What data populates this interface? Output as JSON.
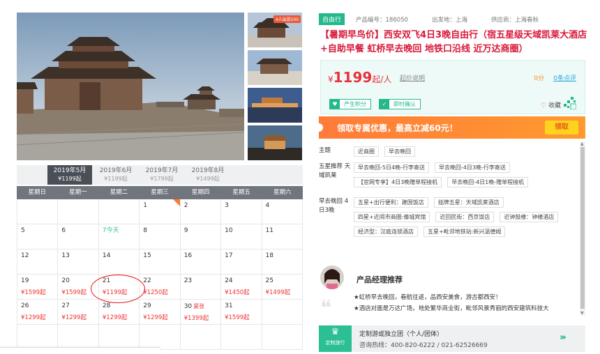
{
  "gallery": {
    "thumb_badge": "4人出游200"
  },
  "calendar": {
    "months": [
      {
        "label": "2019年5月",
        "price": "¥1199起",
        "active": true
      },
      {
        "label": "2019年6月",
        "price": "¥1199起"
      },
      {
        "label": "2019年7月",
        "price": "¥1799起"
      },
      {
        "label": "2019年8月",
        "price": "¥1499起"
      }
    ],
    "weekdays": [
      "星期日",
      "星期一",
      "星期二",
      "星期三",
      "星期四",
      "星期五",
      "星期六"
    ],
    "today_label": "今天",
    "rows": [
      [
        {
          "d": ""
        },
        {
          "d": ""
        },
        {
          "d": ""
        },
        {
          "d": "1",
          "flag": true
        },
        {
          "d": "2"
        },
        {
          "d": "3"
        },
        {
          "d": "4"
        }
      ],
      [
        {
          "d": "5"
        },
        {
          "d": "6"
        },
        {
          "d": "7",
          "today": true
        },
        {
          "d": "8"
        },
        {
          "d": "9"
        },
        {
          "d": "10"
        },
        {
          "d": "11"
        }
      ],
      [
        {
          "d": "12"
        },
        {
          "d": "13"
        },
        {
          "d": "14"
        },
        {
          "d": "15"
        },
        {
          "d": "16"
        },
        {
          "d": "17"
        },
        {
          "d": "18"
        }
      ],
      [
        {
          "d": "19",
          "p": "¥1599起"
        },
        {
          "d": "20",
          "p": "¥1599起"
        },
        {
          "d": "21",
          "p": "¥1199起"
        },
        {
          "d": "22",
          "p": "¥1250起"
        },
        {
          "d": "23"
        },
        {
          "d": "24",
          "p": "¥1450起"
        },
        {
          "d": "25",
          "p": "¥1499起"
        }
      ],
      [
        {
          "d": "26",
          "p": "¥1299起"
        },
        {
          "d": "27",
          "p": "¥1299起"
        },
        {
          "d": "28",
          "p": "¥1299起"
        },
        {
          "d": "29",
          "p": "¥1299起"
        },
        {
          "d": "30",
          "p": "¥1399起",
          "tag": "紧张"
        },
        {
          "d": "31",
          "p": "¥1599起"
        },
        {
          "d": ""
        }
      ],
      [
        {
          "d": ""
        },
        {
          "d": ""
        },
        {
          "d": ""
        },
        {
          "d": ""
        },
        {
          "d": ""
        },
        {
          "d": ""
        },
        {
          "d": ""
        }
      ]
    ]
  },
  "product": {
    "badge": "自由行",
    "code": "产品编号：186050",
    "departure": "出发地：上海",
    "supplier": "供应商：上海春秋",
    "title": "【暑期早鸟价】西安双飞4日3晚自由行（宿五星级天域凯莱大酒店+自助早餐 虹桥早去晚回 地铁口沿线 近万达商圈）",
    "price_currency": "¥",
    "price_value": "1199",
    "price_unit": "起/人",
    "price_note": "起价说明",
    "score": "0分",
    "reviews": "0条点评",
    "feature1": "产生积分",
    "feature2": "即时确认",
    "favorite": "收藏"
  },
  "promo": {
    "text": "领取专属优惠，最高立减60元！",
    "button": "领取"
  },
  "details": {
    "theme_label": "主题",
    "theme_tags": [
      "近商圈",
      "早去晚回"
    ],
    "recommend_label": "五星推荐 天域凯莱",
    "recommend_tags": [
      "早去晚回-5日4晚-行李寄送",
      "早去晚回-4日3晚-行李寄送",
      "【官网专享】4日3晚赠单程接机",
      "早去晚回-4日1晚-赠单程接机"
    ],
    "early_label": "早去晚回 4日3晚",
    "early_tags": [
      "五星+出行便利：建国饭店",
      "挂牌五星：天域凯莱酒店",
      "四星+近闹市商圈:傣城宾馆",
      "近回民街：西京饭店",
      "近钟鼓楼：钟楼酒店",
      "经济型：汉庭连锁酒店",
      "五星+毗邻地铁站:新兴温德姆"
    ]
  },
  "manager": {
    "title": "产品经理推荐",
    "lines": [
      "★虹桥早去晚回，春航往返，品西安美食，游古都西安！",
      "★酒店对面是万达广场，地处繁华商业街，毗邻风景秀丽的西安建筑科技大"
    ]
  },
  "custom": {
    "icon_label": "定制旅行",
    "title": "定制游或独立团（个人/团体）",
    "phone": "咨询热线：400-820-6222 / 021-62526669"
  },
  "colors": {
    "accent": "#24b88c",
    "price": "#e8323c",
    "title": "#d8193a",
    "promo": "#ff8a33"
  }
}
